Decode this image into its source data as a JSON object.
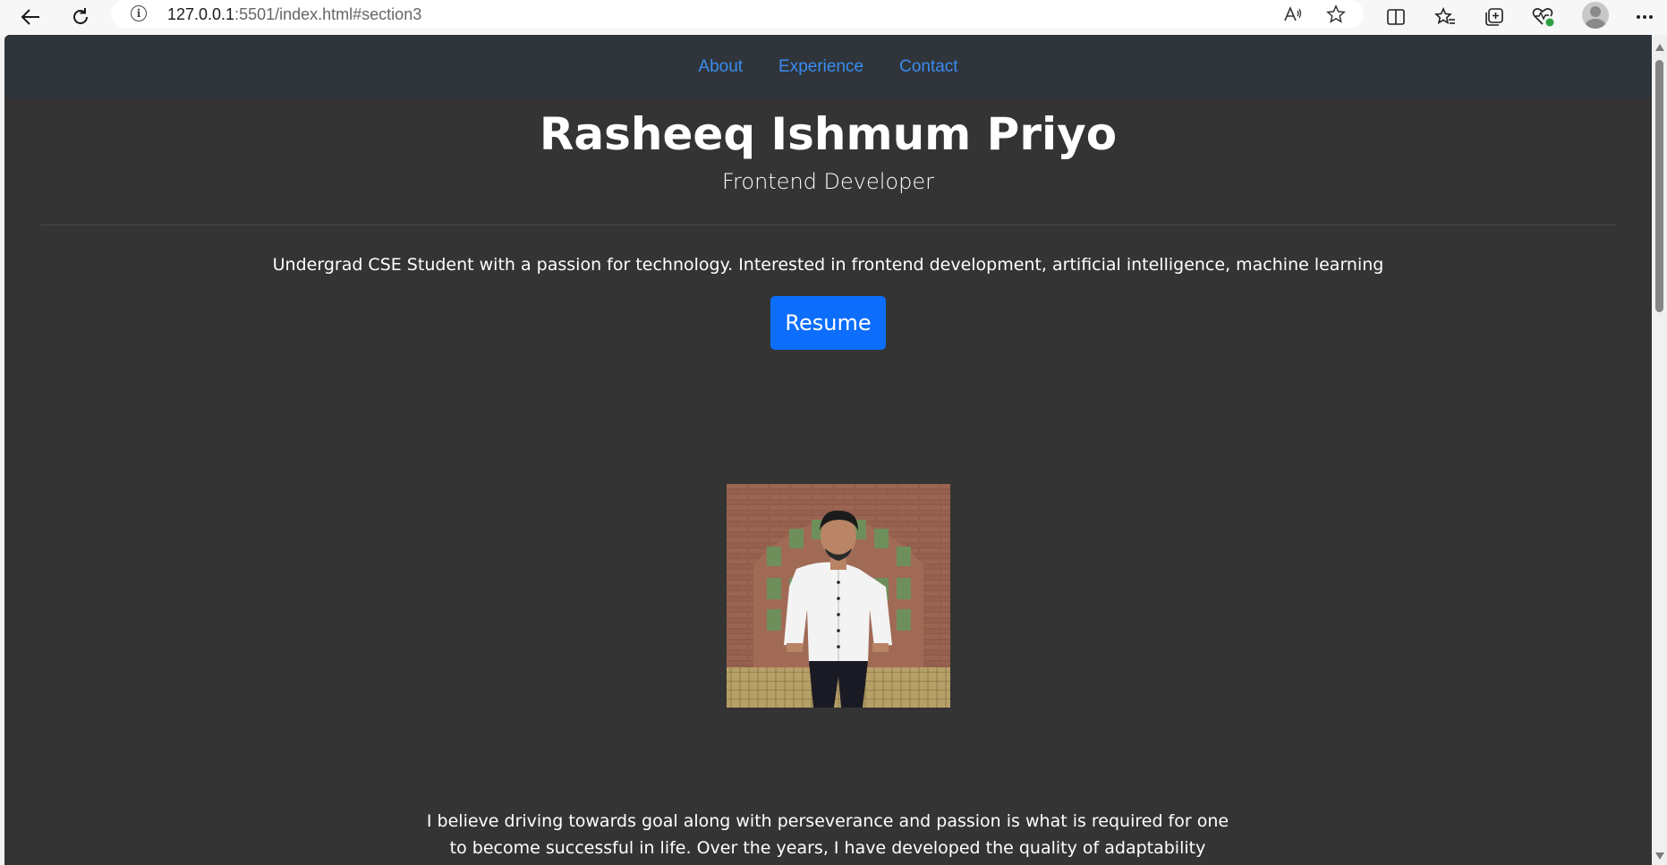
{
  "browser": {
    "url_host": "127.0.0.1",
    "url_rest": ":5501/index.html#section3",
    "icons": {
      "back": "back-arrow-icon",
      "refresh": "refresh-icon",
      "info": "info-icon",
      "read_aloud": "read-aloud-icon",
      "favorite": "star-icon",
      "split_screen": "split-screen-icon",
      "favorites": "favorites-icon",
      "collections": "collections-icon",
      "performance": "heart-pulse-icon",
      "profile": "profile-avatar-icon",
      "more": "more-icon"
    }
  },
  "site_nav": {
    "links": [
      "About",
      "Experience",
      "Contact"
    ]
  },
  "hero": {
    "name": "Rasheeq Ishmum Priyo",
    "role": "Frontend Developer",
    "intro": "Undergrad CSE Student with a passion for technology. Interested in frontend development, artificial intelligence, machine learning",
    "resume_label": "Resume"
  },
  "about": {
    "line1": "I believe driving towards goal along with perseverance and passion is what is required for one",
    "line2": "to become successful in life. Over the years, I have developed the quality of adaptability while"
  },
  "colors": {
    "page_bg": "#343434",
    "nav_bg": "#2f353a",
    "link": "#3a8cf0",
    "button": "#0d6efd"
  }
}
